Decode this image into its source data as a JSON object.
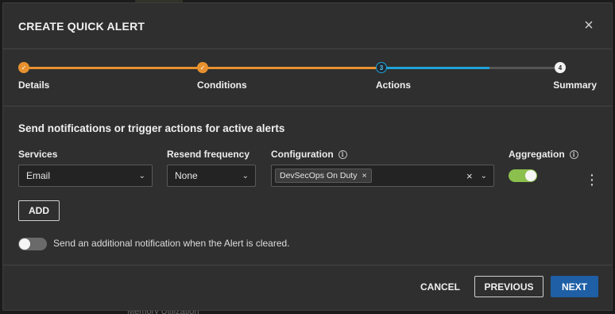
{
  "backdrop": {
    "partial_text": "Memory Utilization"
  },
  "dialog": {
    "title": "CREATE QUICK ALERT",
    "close_icon": "close-icon"
  },
  "stepper": {
    "steps": [
      {
        "label": "Details",
        "state": "done",
        "marker": "✓"
      },
      {
        "label": "Conditions",
        "state": "done",
        "marker": "✓"
      },
      {
        "label": "Actions",
        "state": "current",
        "marker": "3"
      },
      {
        "label": "Summary",
        "state": "todo",
        "marker": "4"
      }
    ],
    "colors": {
      "done": "#e7912e",
      "current": "#1fa1d8",
      "todo": "#555555"
    },
    "current_step_progress": 0.6
  },
  "section": {
    "title": "Send notifications or trigger actions for active alerts"
  },
  "fields": {
    "services": {
      "label": "Services",
      "value": "Email"
    },
    "resend": {
      "label": "Resend frequency",
      "value": "None"
    },
    "configuration": {
      "label": "Configuration",
      "chip": "DevSecOps On Duty",
      "clear": "×"
    },
    "aggregation": {
      "label": "Aggregation",
      "enabled": true
    }
  },
  "actions": {
    "add_label": "ADD",
    "cleared_toggle_label": "Send an additional notification when the Alert is cleared.",
    "cleared_enabled": false
  },
  "footer": {
    "cancel_label": "CANCEL",
    "previous_label": "PREVIOUS",
    "next_label": "NEXT"
  },
  "colors": {
    "accent_blue": "#1f5fa5",
    "toggle_on": "#8bbf4e",
    "modal_bg": "#2f2f2f"
  }
}
